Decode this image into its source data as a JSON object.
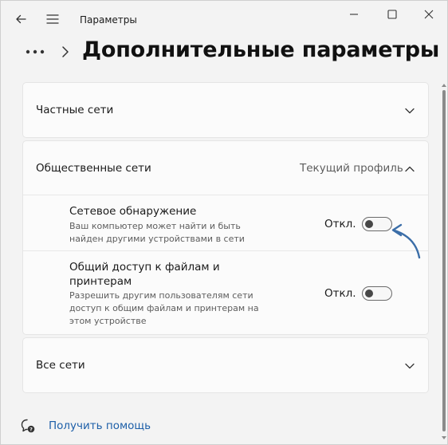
{
  "titlebar": {
    "title": "Параметры",
    "back_icon": "back-arrow-icon",
    "menu_icon": "hamburger-menu-icon",
    "controls": [
      "minimize-icon",
      "maximize-icon",
      "close-icon"
    ]
  },
  "header": {
    "more_icon": "ellipsis-icon",
    "title": "Дополнительные параметры общего доступа"
  },
  "sections": {
    "private": {
      "label": "Частные сети",
      "expanded": false
    },
    "public": {
      "label": "Общественные сети",
      "current_profile": "Текущий профиль",
      "expanded": true,
      "settings": [
        {
          "title": "Сетевое обнаружение",
          "description_line1": "Ваш компьютер может найти и быть",
          "description_line2": "найден другими устройствами в сети",
          "state_label": "Откл.",
          "on": false
        },
        {
          "title_line1": "Общий доступ к файлам и",
          "title_line2": "принтерам",
          "description_line1": "Разрешить другим пользователям сети",
          "description_line2": "доступ к общим файлам и принтерам на",
          "description_line3": "этом устройстве",
          "state_label": "Откл.",
          "on": false
        }
      ]
    },
    "all": {
      "label": "Все сети",
      "expanded": false
    }
  },
  "help": {
    "icon": "help-chat-icon",
    "label": "Получить помощь"
  },
  "colors": {
    "background": "#f3f3f3",
    "card": "#fbfbfb",
    "link": "#1d5fa8",
    "annotation_arrow": "#3b6ea8"
  }
}
